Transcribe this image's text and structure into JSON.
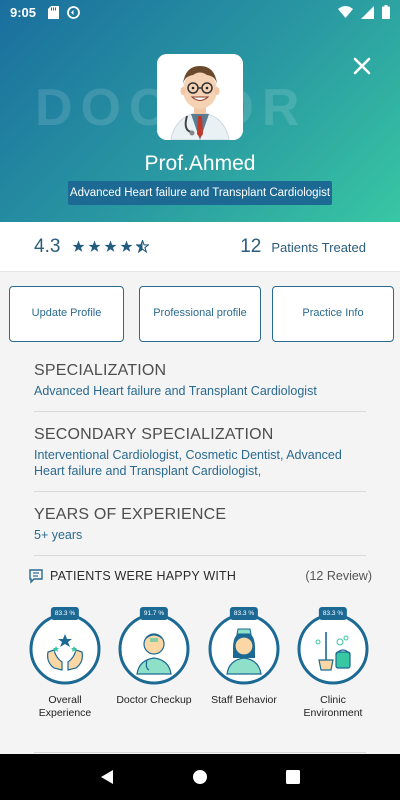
{
  "status_bar": {
    "time": "9:05"
  },
  "header": {
    "watermark": "DOCTOR",
    "doctor_name": "Prof.Ahmed",
    "specialty_badge": "Advanced Heart failure and Transplant Cardiologist"
  },
  "stats": {
    "rating": "4.3",
    "stars_filled": 4,
    "stars_half": 1,
    "patients_count": "12",
    "patients_label": "Patients Treated"
  },
  "actions": [
    {
      "label": "Update Profile"
    },
    {
      "label": "Professional profile"
    },
    {
      "label": "Practice Info"
    }
  ],
  "sections": {
    "specialization": {
      "title": "SPECIALIZATION",
      "value": "Advanced Heart failure and Transplant Cardiologist"
    },
    "secondary": {
      "title": "SECONDARY SPECIALIZATION",
      "value": "Interventional Cardiologist, Cosmetic Dentist, Advanced Heart failure and Transplant Cardiologist,"
    },
    "experience": {
      "title": "YEARS OF EXPERIENCE",
      "value": "5+ years"
    }
  },
  "happy": {
    "title": "PATIENTS WERE HAPPY WITH",
    "reviews": "(12  Review)",
    "metrics": [
      {
        "pct": "83.3 %",
        "label": "Overall Experience",
        "icon": "hands-stars-icon"
      },
      {
        "pct": "91.7 %",
        "label": "Doctor Checkup",
        "icon": "doctor-icon"
      },
      {
        "pct": "83.3 %",
        "label": "Staff Behavior",
        "icon": "nurse-icon"
      },
      {
        "pct": "83.3 %",
        "label": "Clinic Environment",
        "icon": "cleaning-icon"
      }
    ]
  },
  "colors": {
    "primary": "#1c6a94",
    "accent": "#2a6a8f",
    "teal": "#38c7a3"
  }
}
